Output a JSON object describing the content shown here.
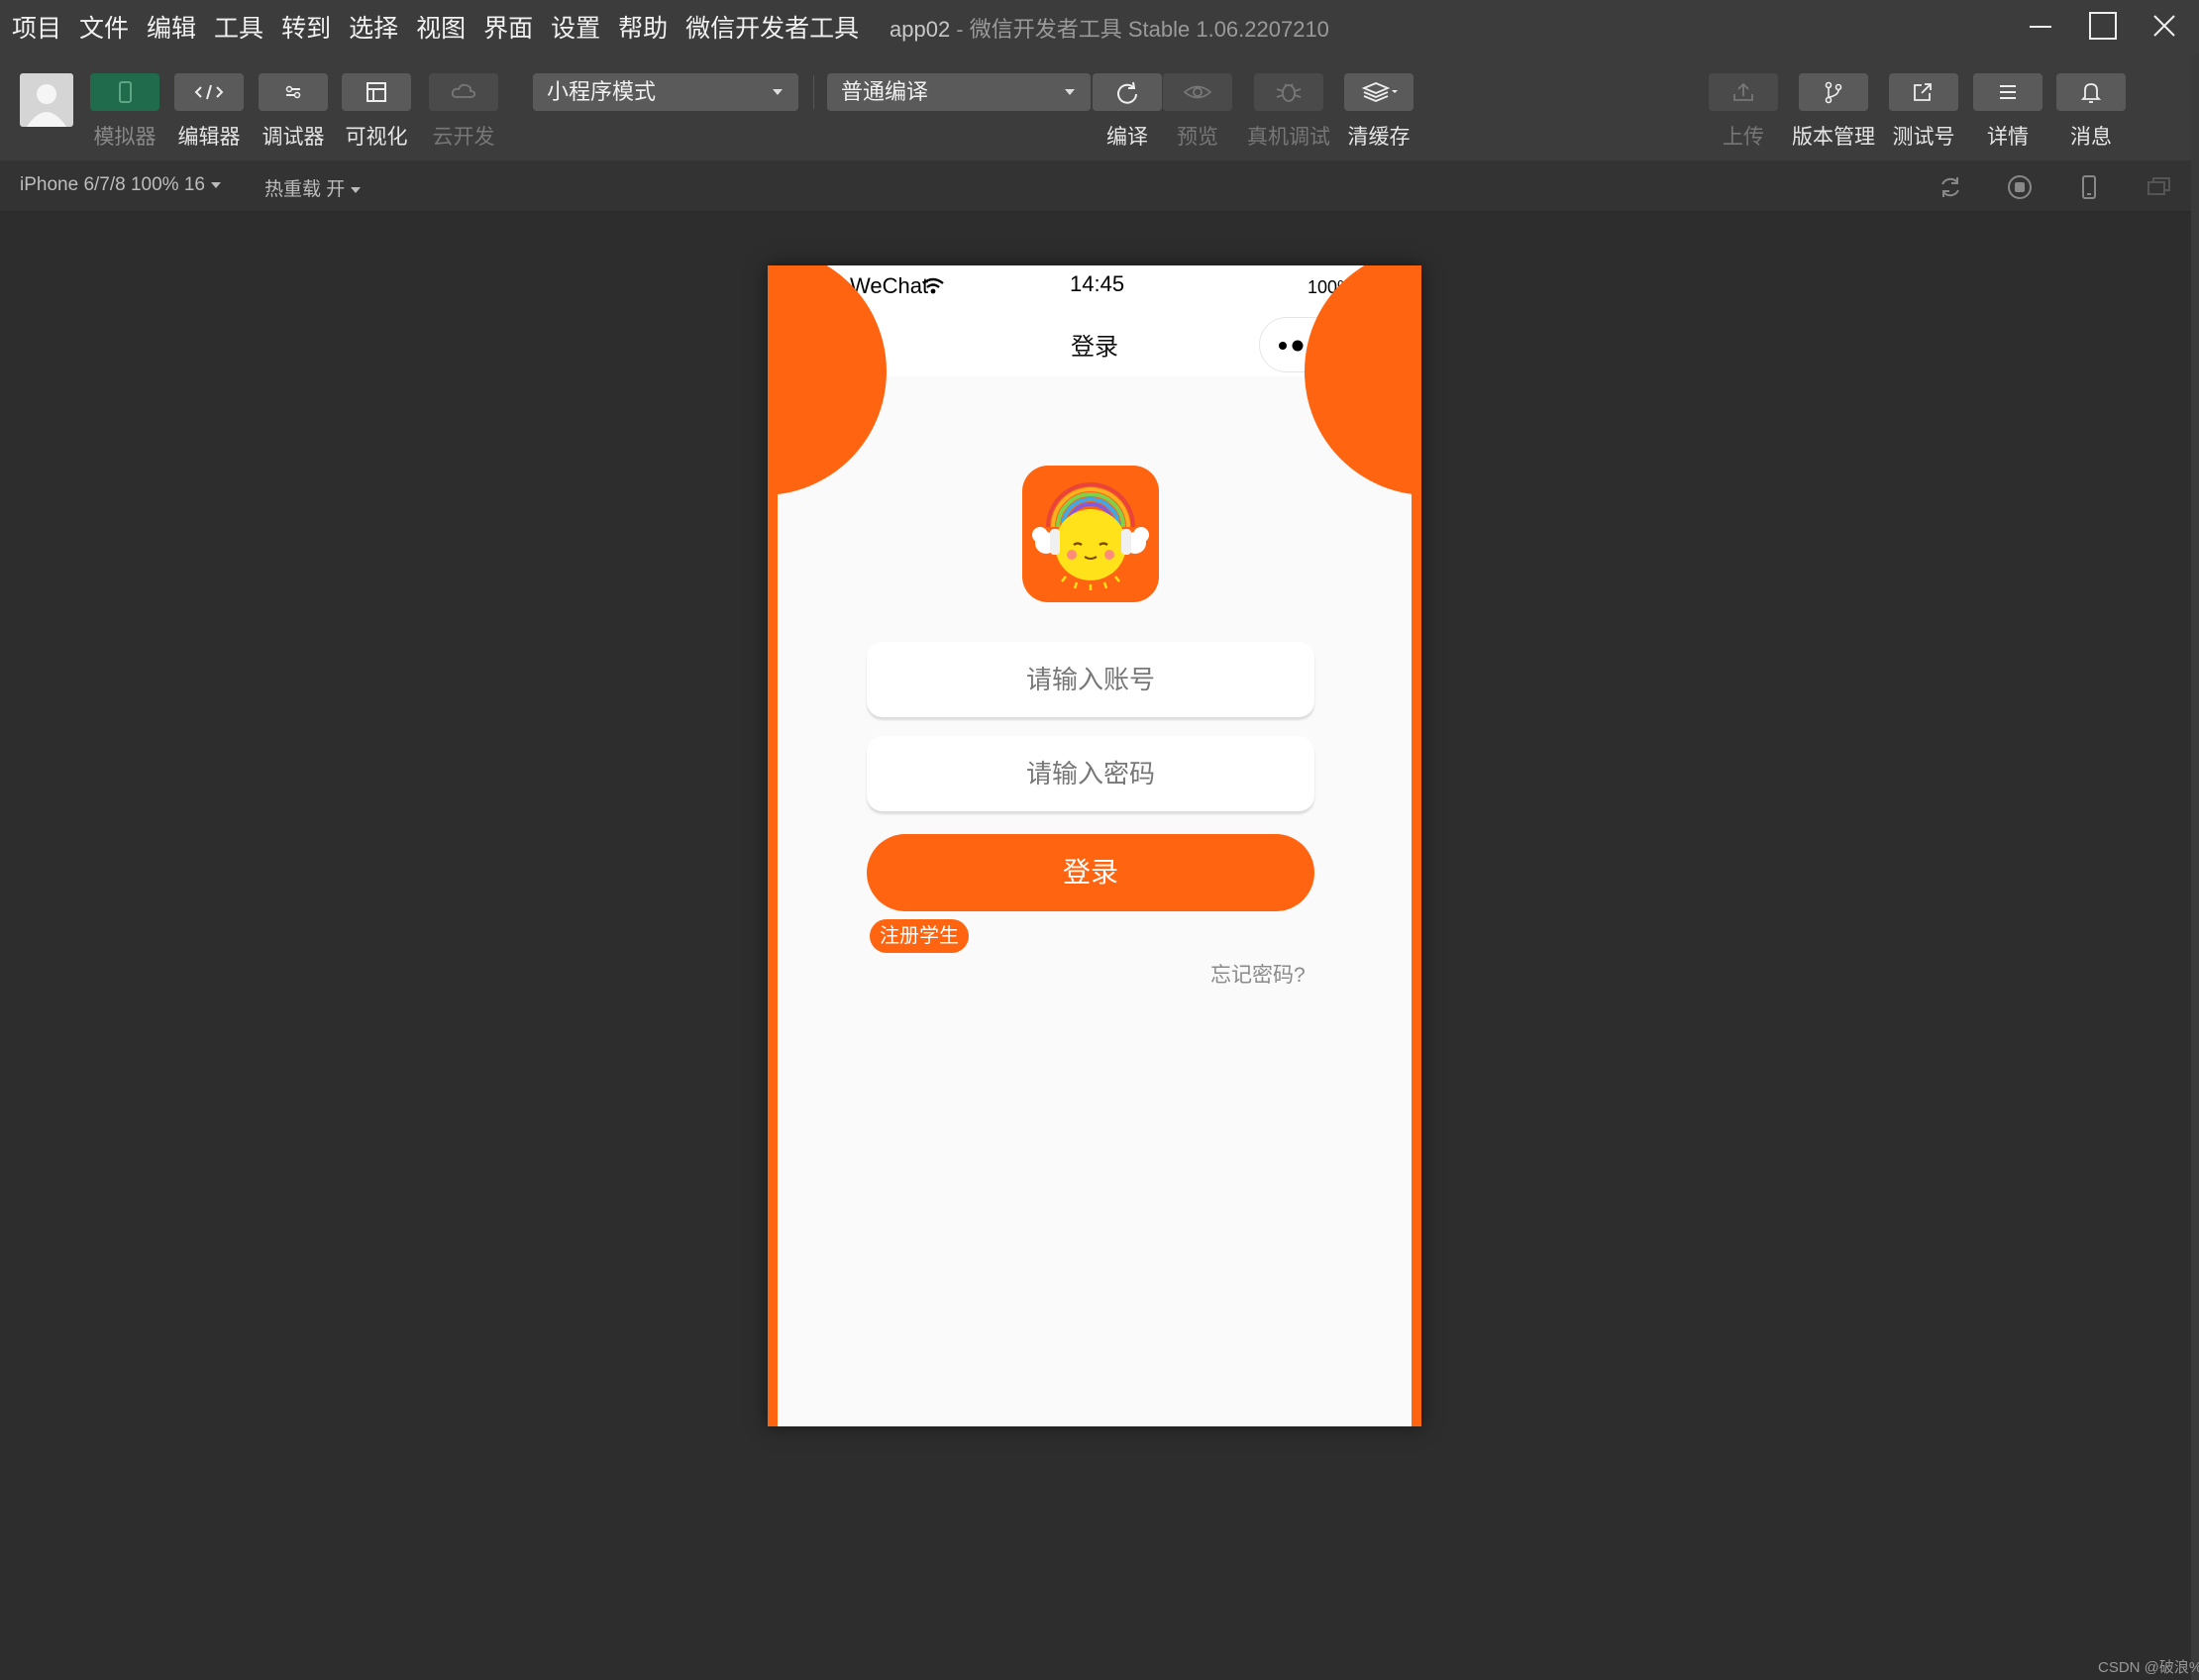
{
  "menubar": {
    "items": [
      "项目",
      "文件",
      "编辑",
      "工具",
      "转到",
      "选择",
      "视图",
      "界面",
      "设置",
      "帮助",
      "微信开发者工具"
    ],
    "project_name": "app02",
    "app_title": " - 微信开发者工具 Stable 1.06.2207210"
  },
  "toolbar": {
    "simulator_label": "模拟器",
    "editor_label": "编辑器",
    "debugger_label": "调试器",
    "visual_label": "可视化",
    "cloud_label": "云开发",
    "mode_select": "小程序模式",
    "compile_select": "普通编译",
    "compile_label": "编译",
    "preview_label": "预览",
    "device_debug_label": "真机调试",
    "clear_cache_label": "清缓存",
    "upload_label": "上传",
    "version_label": "版本管理",
    "test_account_label": "测试号",
    "details_label": "详情",
    "messages_label": "消息"
  },
  "devicebar": {
    "device": "iPhone 6/7/8 100% 16",
    "hot_reload": "热重载 开"
  },
  "simulator": {
    "status": {
      "signal": "●●●●●",
      "carrier": "WeChat",
      "time": "14:45",
      "battery": "100%"
    },
    "nav_title": "登录",
    "login_page": {
      "account_placeholder": "请输入账号",
      "password_placeholder": "请输入密码",
      "login_button": "登录",
      "register_label": "注册学生",
      "forgot_label": "忘记密码?"
    }
  },
  "watermark": "CSDN @破浪%",
  "colors": {
    "accent": "#ff6510",
    "ide_bg": "#2d2d2d",
    "toolbar_bg": "#3c3c3c",
    "active_green": "#1f6b4b"
  }
}
